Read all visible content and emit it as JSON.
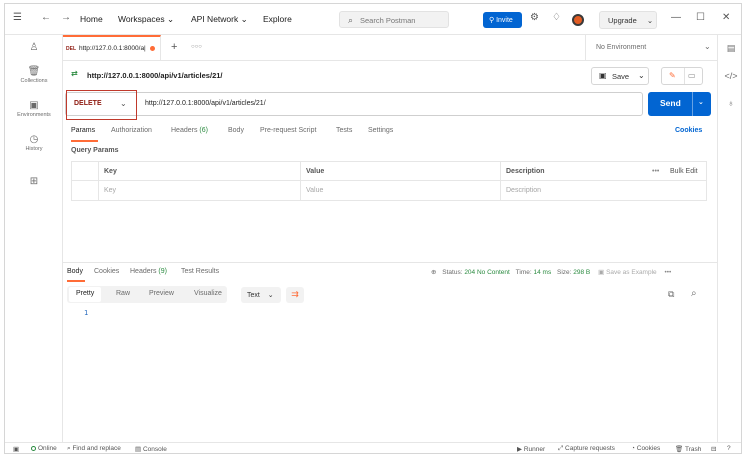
{
  "topbar": {
    "menu_icon": "hamburger-icon",
    "home": "Home",
    "workspaces": "Workspaces",
    "api_network": "API Network",
    "explore": "Explore",
    "search_placeholder": "Search Postman",
    "invite": "Invite",
    "upgrade": "Upgrade"
  },
  "sidebar": {
    "items": [
      {
        "label": "",
        "icon": "user-icon"
      },
      {
        "label": "Collections",
        "icon": "collections-icon"
      },
      {
        "label": "Environments",
        "icon": "environments-icon"
      },
      {
        "label": "History",
        "icon": "history-icon"
      },
      {
        "label": "",
        "icon": "apps-icon"
      }
    ]
  },
  "tab": {
    "method": "DEL",
    "label": "http://127.0.0.1:8000/a|",
    "environment": "No Environment"
  },
  "request": {
    "title": "http://127.0.0.1:8000/api/v1/articles/21/",
    "save": "Save",
    "method": "DELETE",
    "url": "http://127.0.0.1:8000/api/v1/articles/21/",
    "send": "Send"
  },
  "subtabs": {
    "params": "Params",
    "authorization": "Authorization",
    "headers": "Headers",
    "headers_count": "(6)",
    "body": "Body",
    "prerequest": "Pre-request Script",
    "tests": "Tests",
    "settings": "Settings",
    "cookies": "Cookies"
  },
  "query_params": {
    "title": "Query Params",
    "headers": {
      "key": "Key",
      "value": "Value",
      "description": "Description",
      "bulk_edit": "Bulk Edit",
      "more": "•••"
    },
    "placeholders": {
      "key": "Key",
      "value": "Value",
      "description": "Description"
    }
  },
  "response": {
    "tabs": {
      "body": "Body",
      "cookies": "Cookies",
      "headers": "Headers",
      "headers_count": "(9)",
      "test_results": "Test Results"
    },
    "status_label": "Status:",
    "status_value": "204 No Content",
    "time_label": "Time:",
    "time_value": "14 ms",
    "size_label": "Size:",
    "size_value": "298 B",
    "save_example": "Save as Example",
    "more": "•••",
    "views": {
      "pretty": "Pretty",
      "raw": "Raw",
      "preview": "Preview",
      "visualize": "Visualize"
    },
    "format": "Text",
    "line_number": "1"
  },
  "bottombar": {
    "online": "Online",
    "find_replace": "Find and replace",
    "console": "Console",
    "runner": "Runner",
    "capture": "Capture requests",
    "cookies": "Cookies",
    "trash": "Trash"
  },
  "colors": {
    "accent": "#ff6c37",
    "primary": "#0265d2",
    "delete_method": "#8e1a10",
    "success": "#2a8a3f",
    "highlight_box": "#c0392b"
  }
}
